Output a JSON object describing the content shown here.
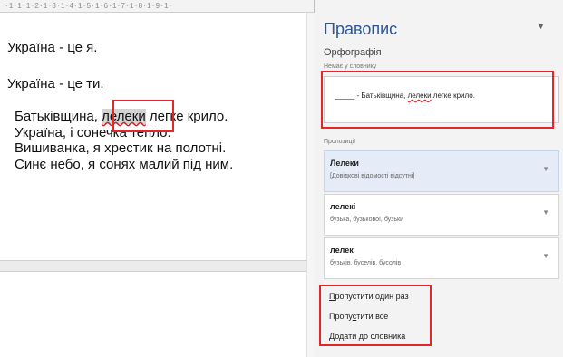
{
  "ruler": {
    "text": "·1·1·1·2·1·3·1·4·1·5·1·6·1·7·1·8·1·9·1·"
  },
  "document": {
    "line1": "Україна - це я.",
    "line2": "Україна - це ти.",
    "para1_before": "Батьківщина, ",
    "para1_word": "лелеки",
    "para1_after": " легке крило.",
    "para2": "Україна, і сонечка тепло.",
    "para3": "Вишиванка, я хрестик на полотні.",
    "para4": "Синє небо, я сонях малий під ним."
  },
  "pane": {
    "title": "Правопис",
    "subtitle": "Орфографія",
    "not_in_dict_label": "Немає у словнику",
    "context_blank": "_____",
    "context_before": " - Батьківщина, ",
    "context_word": "лелеки",
    "context_after": " легке крило.",
    "suggestions_label": "Пропозиції",
    "suggestions": [
      {
        "word": "Лелеки",
        "def": "[Довідкові відомості відсутні]"
      },
      {
        "word": "лелекі",
        "def": "бузька, бузькової, бузьки"
      },
      {
        "word": "лелек",
        "def": "бузьків, буселів, бусолів"
      }
    ],
    "actions": {
      "ignore_once_u": "П",
      "ignore_once_rest": "ропустити один раз",
      "ignore_all_a": "Пропу",
      "ignore_all_u": "с",
      "ignore_all_b": "тити все",
      "add_u": "Д",
      "add_rest": "одати до словника"
    }
  }
}
